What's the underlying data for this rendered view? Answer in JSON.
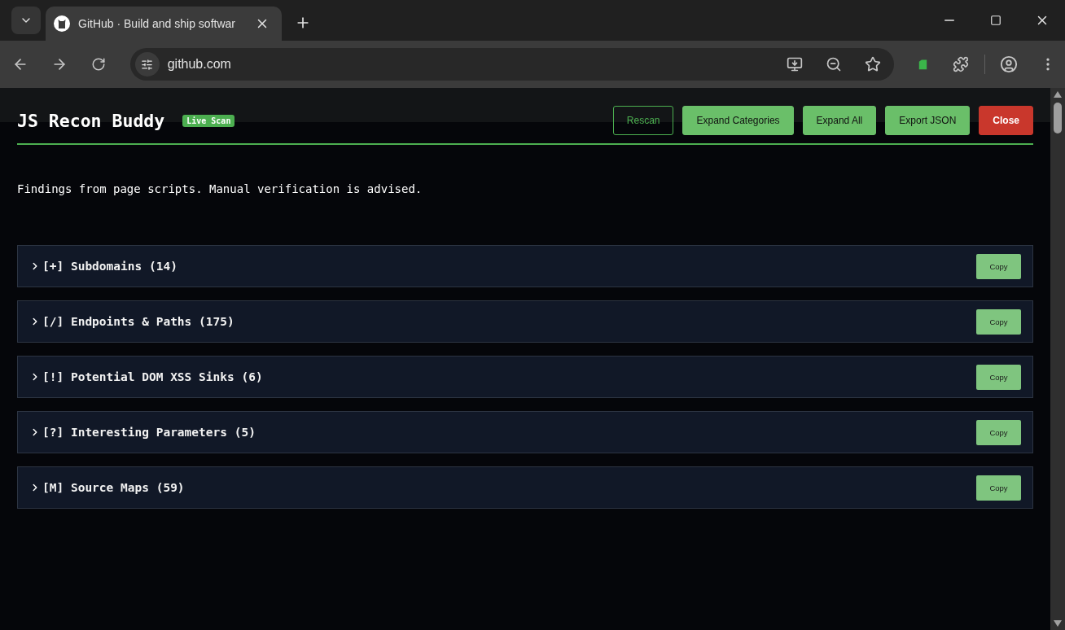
{
  "browser": {
    "tab": {
      "title": "GitHub · Build and ship softwar"
    },
    "url": "github.com"
  },
  "panel": {
    "title": "JS Recon Buddy",
    "badge": "Live Scan",
    "buttons": [
      {
        "label": "Rescan",
        "kind": "outline"
      },
      {
        "label": "Expand Categories",
        "kind": "primary"
      },
      {
        "label": "Expand All",
        "kind": "primary"
      },
      {
        "label": "Export JSON",
        "kind": "primary"
      },
      {
        "label": "Close",
        "kind": "danger"
      }
    ],
    "subtitle": "Findings from page scripts. Manual verification is advised.",
    "categories": [
      {
        "label": "[+] Subdomains (14)",
        "expanded": false,
        "action": "Copy"
      },
      {
        "label": "[/] Endpoints & Paths (175)",
        "expanded": false,
        "action": "Copy"
      },
      {
        "label": "[!] Potential DOM XSS Sinks (6)",
        "expanded": false,
        "action": "Copy"
      },
      {
        "label": "[?] Interesting Parameters (5)",
        "expanded": false,
        "action": "Copy"
      },
      {
        "label": "[M] Source Maps (59)",
        "expanded": false,
        "action": "Copy"
      }
    ]
  }
}
